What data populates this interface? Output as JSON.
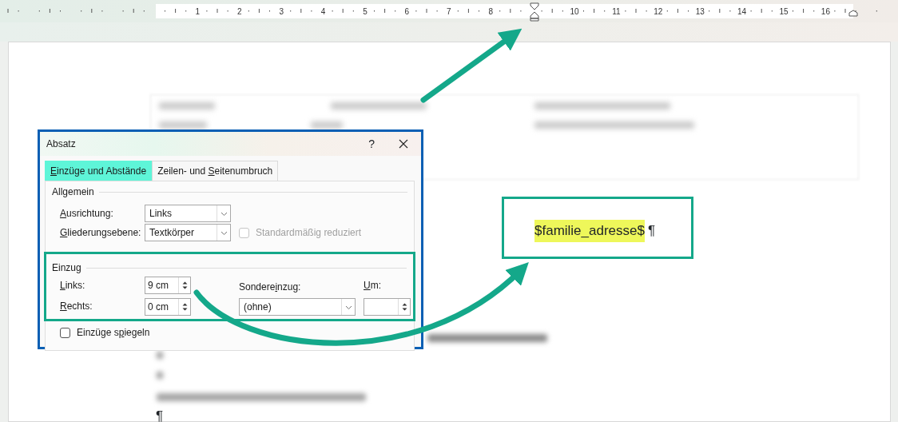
{
  "ruler": {
    "numbers": [
      "1",
      "2",
      "3",
      "4",
      "5",
      "6",
      "7",
      "8",
      "10",
      "11",
      "12",
      "13",
      "14",
      "15",
      "16"
    ]
  },
  "dialog": {
    "title": "Absatz",
    "help": "?",
    "tabs": [
      {
        "label": [
          {
            "text": "E",
            "underlined": true
          },
          {
            "text": "inzüge und Abstände",
            "underlined": false
          }
        ],
        "selected": true
      },
      {
        "label": [
          {
            "text": "Zeilen- und ",
            "underlined": false
          },
          {
            "text": "S",
            "underlined": true
          },
          {
            "text": "eitenumbruch",
            "underlined": false
          }
        ],
        "selected": false
      }
    ],
    "general": {
      "title": "Allgemein",
      "alignment": {
        "label": [
          {
            "text": "A",
            "underlined": true
          },
          {
            "text": "usrichtung:",
            "underlined": false
          }
        ],
        "value": "Links"
      },
      "outline_level": {
        "label": [
          {
            "text": "G",
            "underlined": true
          },
          {
            "text": "liederungsebene:",
            "underlined": false
          }
        ],
        "value": "Textkörper"
      },
      "collapsed": {
        "label": "Standardmäßig reduziert",
        "checked": false,
        "disabled": true
      }
    },
    "indent": {
      "title": "Einzug",
      "highlighted": true,
      "left": {
        "label": [
          {
            "text": "L",
            "underlined": true
          },
          {
            "text": "inks:",
            "underlined": false
          }
        ],
        "value": "9 cm"
      },
      "right": {
        "label": [
          {
            "text": "R",
            "underlined": true
          },
          {
            "text": "echts:",
            "underlined": false
          }
        ],
        "value": "0 cm"
      },
      "special": {
        "label": [
          {
            "text": "Sondere",
            "underlined": false
          },
          {
            "text": "i",
            "underlined": true
          },
          {
            "text": "nzug:",
            "underlined": false
          }
        ],
        "value": "(ohne)"
      },
      "by": {
        "label": [
          {
            "text": "U",
            "underlined": true
          },
          {
            "text": "m:",
            "underlined": false
          }
        ]
      },
      "mirror": {
        "label": [
          {
            "text": "Einzüge s",
            "underlined": false
          },
          {
            "text": "p",
            "underlined": true
          },
          {
            "text": "iegeln",
            "underlined": false
          }
        ],
        "checked": false
      }
    }
  },
  "callout": {
    "text": "$familie_adresse$",
    "highlighted": true,
    "mark": "¶"
  },
  "document": {
    "last_mark": "¶"
  }
}
